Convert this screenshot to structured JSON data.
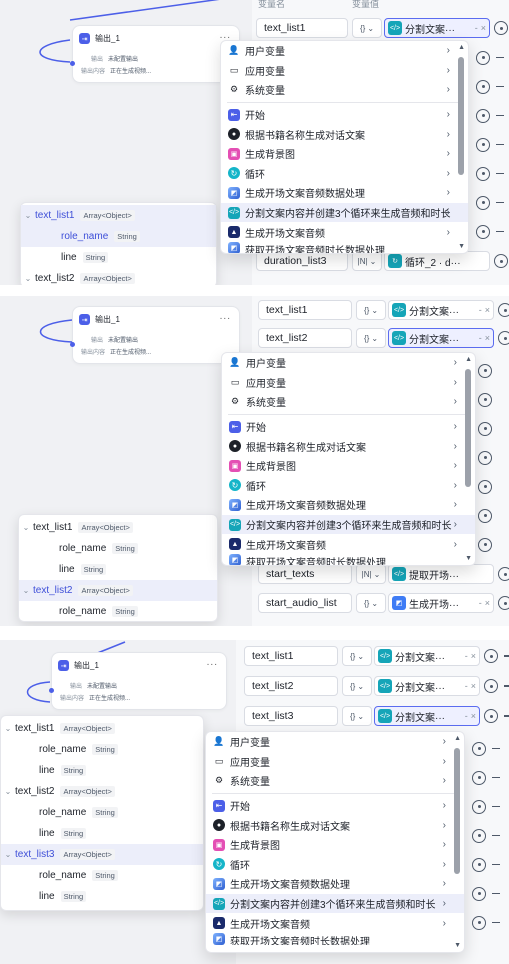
{
  "node": {
    "title": "输出_1",
    "more": "...",
    "row1_label": "输出",
    "row1_value": "未配置输出",
    "row2_label": "输出内容",
    "row2_value": "正在生成视频..."
  },
  "table_header": {
    "name": "变量名",
    "value": "变量值"
  },
  "menu": {
    "groups": [
      "用户变量",
      "应用变量",
      "系统变量"
    ],
    "nodes": [
      "开始",
      "根据书籍名称生成对话文案",
      "生成背景图",
      "循环",
      "生成开场文案音频数据处理",
      "分割文案内容并创建3个循环来生成音频和时长",
      "生成开场文案音频",
      "获取开场文案音频时长数据处理"
    ]
  },
  "panel1": {
    "rows": [
      {
        "name": "text_list1",
        "type": "{}",
        "icon": "code-icon",
        "value": "分割文案···",
        "sep": "-",
        "x": "×"
      },
      {
        "name": "duration_list3",
        "type": "|N|",
        "icon": "loop-icon",
        "value": "循环_2 · d···",
        "sep": "",
        "x": ""
      }
    ],
    "tree": [
      {
        "name": "text_list1",
        "type": "Array<Object>",
        "kind": "parent",
        "selected": true
      },
      {
        "name": "role_name",
        "type": "String",
        "kind": "child",
        "selected": true
      },
      {
        "name": "line",
        "type": "String",
        "kind": "child",
        "selected": false
      },
      {
        "name": "text_list2",
        "type": "Array<Object>",
        "kind": "parent",
        "selected": false
      }
    ]
  },
  "panel2": {
    "rows": [
      {
        "name": "text_list1",
        "type": "{}",
        "icon": "code-icon",
        "value": "分割文案···",
        "sep": "-",
        "x": "×"
      },
      {
        "name": "text_list2",
        "type": "{}",
        "icon": "code-icon",
        "value": "分割文案···",
        "sep": "-",
        "x": "×"
      },
      {
        "name": "start_texts",
        "type": "|N|",
        "icon": "code-icon",
        "value": "提取开场···",
        "sep": "",
        "x": ""
      },
      {
        "name": "start_audio_list",
        "type": "{}",
        "icon": "image-icon",
        "value": "生成开场···",
        "sep": "-",
        "x": "×"
      }
    ],
    "tree": [
      {
        "name": "text_list1",
        "type": "Array<Object>",
        "kind": "parent",
        "selected": false
      },
      {
        "name": "role_name",
        "type": "String",
        "kind": "child",
        "selected": false
      },
      {
        "name": "line",
        "type": "String",
        "kind": "child",
        "selected": false
      },
      {
        "name": "text_list2",
        "type": "Array<Object>",
        "kind": "parent",
        "selected": true
      },
      {
        "name": "role_name",
        "type": "String",
        "kind": "child",
        "selected": false
      }
    ]
  },
  "panel3": {
    "rows": [
      {
        "name": "text_list1",
        "type": "{}",
        "icon": "code-icon",
        "value": "分割文案···",
        "sep": "-",
        "x": "×"
      },
      {
        "name": "text_list2",
        "type": "{}",
        "icon": "code-icon",
        "value": "分割文案···",
        "sep": "-",
        "x": "×"
      },
      {
        "name": "text_list3",
        "type": "{}",
        "icon": "code-icon",
        "value": "分割文案···",
        "sep": "-",
        "x": "×"
      }
    ],
    "tree": [
      {
        "name": "text_list1",
        "type": "Array<Object>",
        "kind": "parent",
        "selected": false
      },
      {
        "name": "role_name",
        "type": "String",
        "kind": "child",
        "selected": false
      },
      {
        "name": "line",
        "type": "String",
        "kind": "child",
        "selected": false
      },
      {
        "name": "text_list2",
        "type": "Array<Object>",
        "kind": "parent",
        "selected": false
      },
      {
        "name": "role_name",
        "type": "String",
        "kind": "child",
        "selected": false
      },
      {
        "name": "line",
        "type": "String",
        "kind": "child",
        "selected": false
      },
      {
        "name": "text_list3",
        "type": "Array<Object>",
        "kind": "parent",
        "selected": true
      },
      {
        "name": "role_name",
        "type": "String",
        "kind": "child",
        "selected": false
      },
      {
        "name": "line",
        "type": "String",
        "kind": "child",
        "selected": false
      }
    ]
  },
  "colors": {
    "accent": "#4c5fe8",
    "focus_border": "#5b6cf0",
    "selection": "#eceefa"
  }
}
